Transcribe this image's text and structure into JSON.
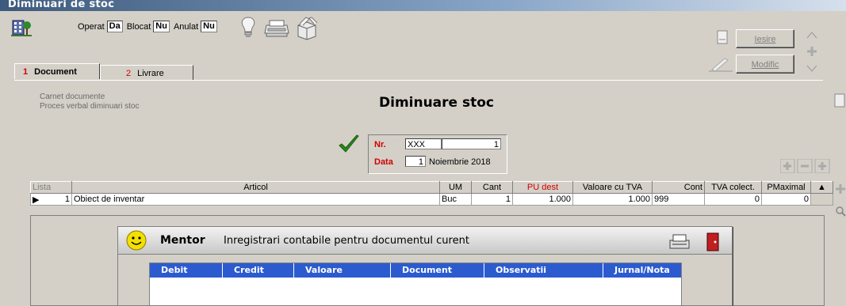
{
  "window": {
    "title": "Diminuari de stoc"
  },
  "toolbar": {
    "operat_label": "Operat",
    "operat_value": "Da",
    "blocat_label": "Blocat",
    "blocat_value": "Nu",
    "anulat_label": "Anulat",
    "anulat_value": "Nu",
    "icons": [
      "lightbulb-icon",
      "printer-icon",
      "open-box-icon"
    ]
  },
  "buttons": {
    "iesire": "Iesire",
    "modific": "Modific"
  },
  "tabs": [
    {
      "num": "1",
      "label": "Document"
    },
    {
      "num": "2",
      "label": "Livrare"
    }
  ],
  "doc": {
    "carnet_label": "Carnet documente",
    "carnet_value": "Proces verbal diminuari stoc",
    "title": "Diminuare stoc",
    "nr_label": "Nr.",
    "nr_series": "XXX",
    "nr_value": "1",
    "data_label": "Data",
    "data_day": "1",
    "data_month_year": "Noiembrie 2018"
  },
  "grid": {
    "columns": [
      "Lista",
      "Articol",
      "UM",
      "Cant",
      "PU dest",
      "Valoare cu TVA",
      "Cont",
      "TVA colect.",
      "PMaximal"
    ],
    "rows": [
      {
        "lista": "1",
        "articol": "Obiect de inventar",
        "um": "Buc",
        "cant": "1",
        "pu_dest": "1.000",
        "valoare": "1.000",
        "cont": "999",
        "tva": "0",
        "pmax": "0"
      }
    ]
  },
  "mentor": {
    "brand": "Mentor",
    "caption": "Inregistrari contabile pentru documentul curent",
    "columns": [
      "Debit",
      "Credit",
      "Valoare",
      "Document",
      "Observatii",
      "Jurnal/Nota"
    ]
  },
  "colors": {
    "accent_red": "#d00000",
    "grid_header_blue": "#2b5bcf",
    "titlebar": "#3d5a7d"
  }
}
